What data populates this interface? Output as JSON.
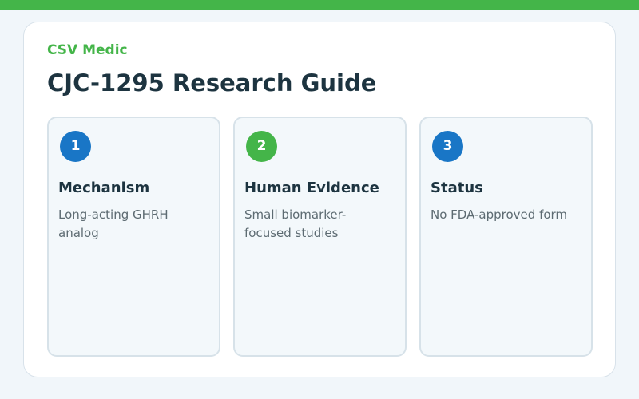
{
  "colors": {
    "brand_green": "#44b549",
    "accent_blue": "#1976c6",
    "heading": "#1d3440",
    "body_text": "#5d6b72"
  },
  "brand": "CSV Medic",
  "title": "CJC-1295 Research Guide",
  "cards": [
    {
      "number": "1",
      "badge_color": "#1976c6",
      "title": "Mechanism",
      "description": "Long-acting GHRH analog"
    },
    {
      "number": "2",
      "badge_color": "#44b549",
      "title": "Human Evidence",
      "description": "Small biomarker-focused studies"
    },
    {
      "number": "3",
      "badge_color": "#1976c6",
      "title": "Status",
      "description": "No FDA-approved form"
    }
  ]
}
